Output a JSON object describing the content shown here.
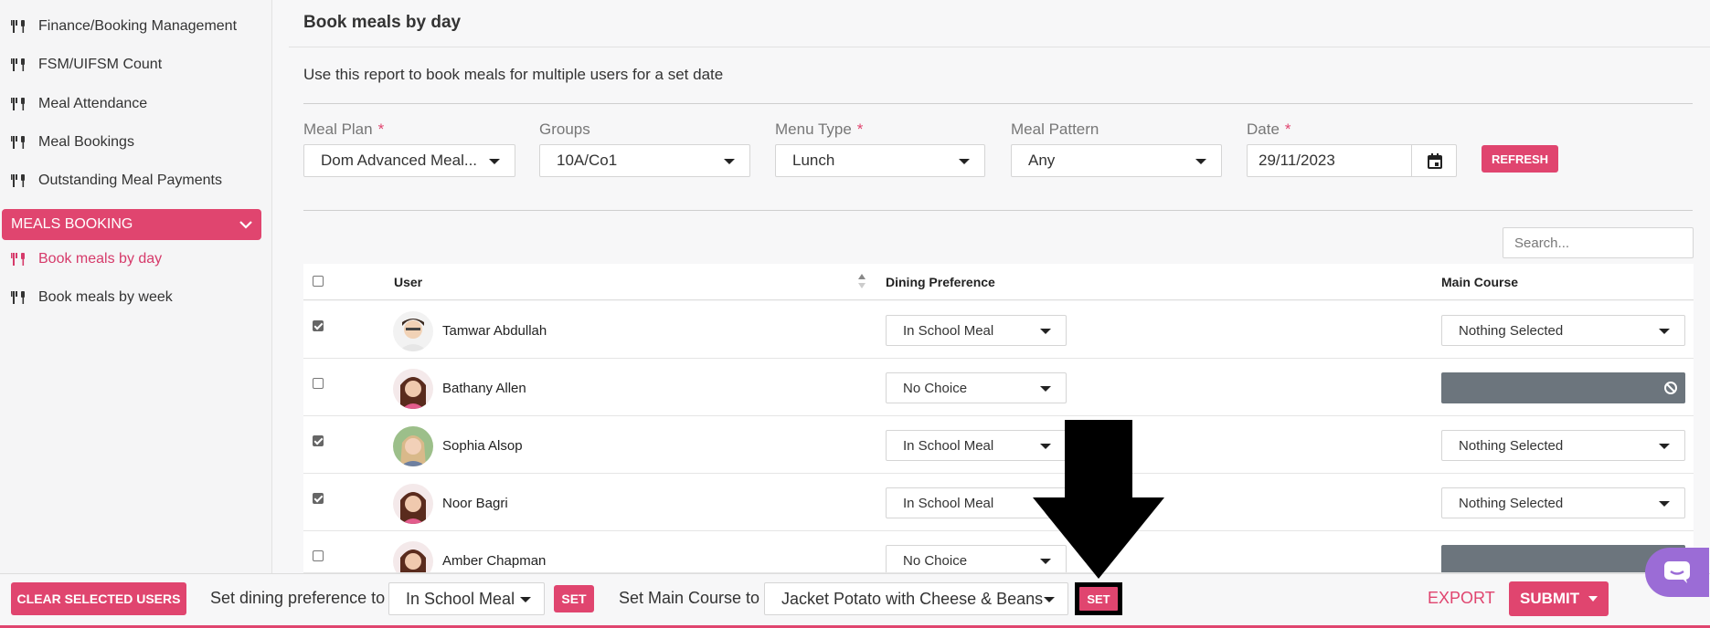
{
  "sidebar": {
    "items": [
      {
        "label": "Finance/Booking Management"
      },
      {
        "label": "FSM/UIFSM Count"
      },
      {
        "label": "Meal Attendance"
      },
      {
        "label": "Meal Bookings"
      },
      {
        "label": "Outstanding Meal Payments"
      }
    ],
    "section": {
      "label": "MEALS BOOKING"
    },
    "sub_items": [
      {
        "label": "Book meals by day",
        "active": true
      },
      {
        "label": "Book meals by week",
        "active": false
      }
    ]
  },
  "page": {
    "title": "Book meals by day",
    "description": "Use this report to book meals for multiple users for a set date"
  },
  "filters": {
    "meal_plan": {
      "label": "Meal Plan",
      "value": "Dom Advanced Meal..."
    },
    "groups": {
      "label": "Groups",
      "value": "10A/Co1"
    },
    "menu_type": {
      "label": "Menu Type",
      "value": "Lunch"
    },
    "meal_pattern": {
      "label": "Meal Pattern",
      "value": "Any"
    },
    "date": {
      "label": "Date",
      "value": "29/11/2023"
    },
    "required_mark": "*",
    "refresh_label": "REFRESH"
  },
  "search": {
    "placeholder": "Search..."
  },
  "table": {
    "headers": {
      "user": "User",
      "dining": "Dining Preference",
      "main": "Main Course"
    },
    "rows": [
      {
        "name": "Tamwar Abdullah",
        "checked": true,
        "dining": "In School Meal",
        "main": "Nothing Selected"
      },
      {
        "name": "Bathany Allen",
        "checked": false,
        "dining": "No Choice",
        "main": ""
      },
      {
        "name": "Sophia Alsop",
        "checked": true,
        "dining": "In School Meal",
        "main": "Nothing Selected"
      },
      {
        "name": "Noor Bagri",
        "checked": true,
        "dining": "In School Meal",
        "main": "Nothing Selected"
      },
      {
        "name": "Amber Chapman",
        "checked": false,
        "dining": "No Choice",
        "main": ""
      }
    ]
  },
  "bottom": {
    "clear_label": "CLEAR SELECTED USERS",
    "set_dining_label": "Set dining preference to",
    "dining_value": "In School Meal",
    "set_label": "SET",
    "set_main_label": "Set Main Course to",
    "main_value": "Jacket Potato with Cheese & Beans",
    "set2_label": "SET",
    "export_label": "EXPORT",
    "submit_label": "SUBMIT"
  },
  "colors": {
    "accent": "#e0456f",
    "disabled": "#6c757d"
  }
}
